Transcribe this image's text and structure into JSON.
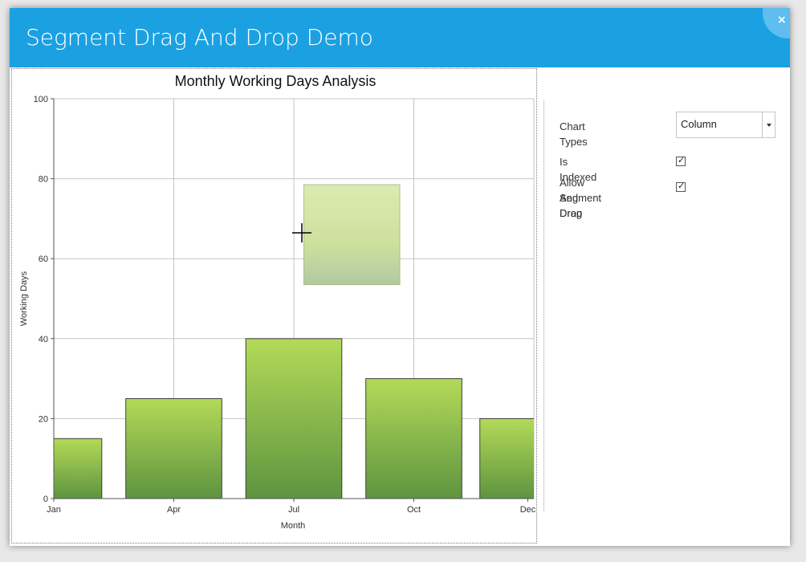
{
  "window": {
    "title": "Segment Drag And Drop Demo",
    "close_glyph": "×",
    "accent_color": "#1ba1e2"
  },
  "settings": {
    "chart_types_label": "Chart Types",
    "chart_type_value": "Column",
    "is_indexed_label": "Is Indexed",
    "is_indexed_checked": true,
    "allow_drag_label_line1": "Allow Segment Drag",
    "allow_drag_label_line2": "And Drop",
    "allow_drag_checked": true,
    "check_glyph": "✓"
  },
  "chart_data": {
    "type": "bar",
    "title": "Monthly Working Days Analysis",
    "xlabel": "Month",
    "ylabel": "Working Days",
    "ylim": [
      0,
      100
    ],
    "yticks": [
      0,
      20,
      40,
      60,
      80,
      100
    ],
    "x_tick_labels": [
      "Jan",
      "Apr",
      "Jul",
      "Oct",
      "Dec"
    ],
    "bars": [
      {
        "category": "Jan",
        "value": 15
      },
      {
        "category": "Apr",
        "value": 25
      },
      {
        "category": "Jul",
        "value": 40
      },
      {
        "category": "Oct",
        "value": 30
      },
      {
        "category": "Dec",
        "value": 20
      }
    ],
    "drag_preview": {
      "low": 53.5,
      "high": 78.5,
      "category": "Jul"
    },
    "grid": true,
    "bar_color_top": "#b3da58",
    "bar_color_bottom": "#5e9440"
  }
}
